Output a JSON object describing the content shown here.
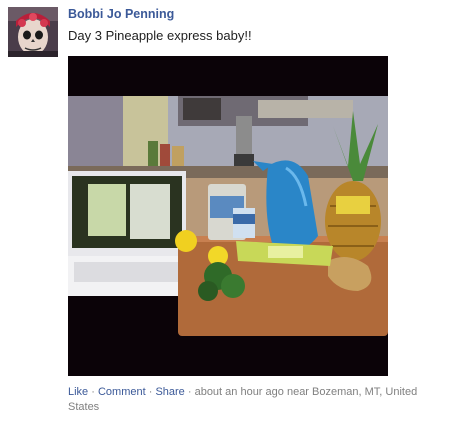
{
  "post": {
    "author_name": "Bobbi Jo Penning",
    "message": "Day 3 Pineapple express baby!!",
    "avatar_icon": "profile-photo",
    "photo": {
      "description_icon": "juice-ingredients-photo",
      "frame_color": "#0b0308"
    }
  },
  "actions": {
    "like_label": "Like",
    "comment_label": "Comment",
    "share_label": "Share",
    "separator": " · "
  },
  "meta": {
    "timestamp": "about an hour ago",
    "location_prefix": "near",
    "location": "Bozeman, MT, United States"
  },
  "colors": {
    "link": "#3b5998",
    "text": "#222222",
    "muted": "#808080"
  }
}
